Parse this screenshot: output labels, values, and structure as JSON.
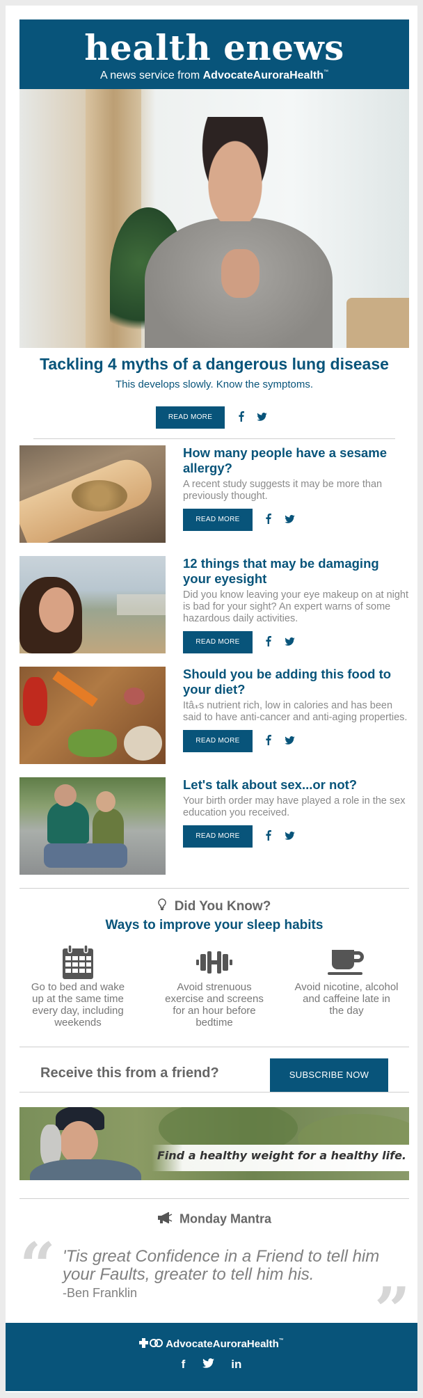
{
  "header": {
    "brand": "health enews",
    "tagline_prefix": "A news service from",
    "tagline_org": "AdvocateAuroraHealth",
    "trademark": "™"
  },
  "colors": {
    "brand_blue": "#08547a",
    "text_gray": "#8a8a8a",
    "heading_gray": "#666666"
  },
  "featured": {
    "image_alt": "Woman coughing holding chest",
    "title": "Tackling 4 myths of a dangerous lung disease",
    "subtitle": "This develops slowly. Know the symptoms.",
    "read_more": "READ MORE",
    "facebook_icon": "f",
    "twitter_icon": "🐦"
  },
  "articles": [
    {
      "image_alt": "Sesame seeds on wooden spoon",
      "title": "How many people have a sesame allergy?",
      "desc": "A recent study suggests it may be more than previously thought.",
      "read_more": "READ MORE"
    },
    {
      "image_alt": "Woman resting chin on hand outdoors",
      "title": "12 things that may be damaging your eyesight",
      "desc": "Did you know leaving your eye makeup on at night is bad for your sight? An expert warns of some hazardous daily activities.",
      "read_more": "READ MORE"
    },
    {
      "image_alt": "Vegetables on cutting board",
      "title": "Should you be adding this food to your diet?",
      "desc": "Itâ𝓍s nutrient rich, low in calories and has been said to have anti-cancer and anti-aging properties.",
      "read_more": "READ MORE"
    },
    {
      "image_alt": "Father and son sitting at skate park",
      "title": "Let's talk about sex...or not?",
      "desc": "Your birth order may have played a role in the sex education you received.",
      "read_more": "READ MORE"
    }
  ],
  "did_you_know": {
    "heading": "Did You Know?",
    "subheading": "Ways to improve your sleep habits",
    "tips": [
      {
        "icon": "calendar-icon",
        "text": "Go to bed and wake up at the same time every day, including weekends"
      },
      {
        "icon": "dumbbell-icon",
        "text": "Avoid strenuous exercise and screens for an hour before bedtime"
      },
      {
        "icon": "coffee-cup-icon",
        "text": "Avoid nicotine, alcohol and caffeine late in the day"
      }
    ]
  },
  "subscribe": {
    "question": "Receive this from a friend?",
    "button": "SUBSCRIBE NOW"
  },
  "banner": {
    "tagline": "Find a healthy weight for a healthy life."
  },
  "mantra": {
    "heading": "Monday Mantra",
    "quote": "'Tis great Confidence in a Friend to tell him your Faults, greater to tell him his.",
    "author": "-Ben Franklin",
    "open_quote": "“",
    "close_quote": "”"
  },
  "footer": {
    "org": "AdvocateAuroraHealth",
    "trademark": "™",
    "social": [
      "f",
      "🐦",
      "in"
    ]
  }
}
